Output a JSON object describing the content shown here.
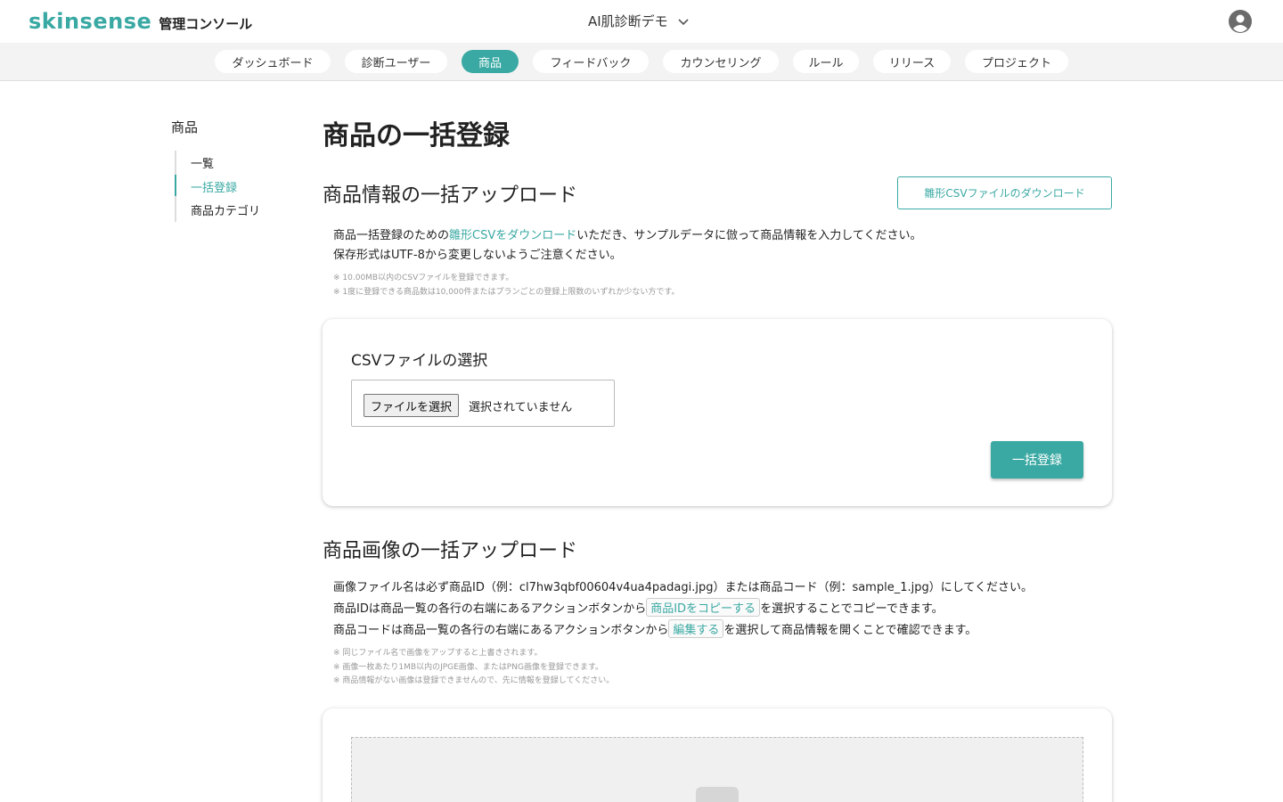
{
  "header": {
    "logo_text": "skinsense",
    "logo_subtitle": "管理コンソール",
    "project_name": "AI肌診断デモ"
  },
  "nav": {
    "tabs": [
      {
        "label": "ダッシュボード"
      },
      {
        "label": "診断ユーザー"
      },
      {
        "label": "商品"
      },
      {
        "label": "フィードバック"
      },
      {
        "label": "カウンセリング"
      },
      {
        "label": "ルール"
      },
      {
        "label": "リリース"
      },
      {
        "label": "プロジェクト"
      }
    ],
    "active": "商品"
  },
  "sidebar": {
    "title": "商品",
    "items": [
      {
        "label": "一覧"
      },
      {
        "label": "一括登録"
      },
      {
        "label": "商品カテゴリ"
      }
    ],
    "active": "一括登録"
  },
  "page": {
    "title": "商品の一括登録"
  },
  "csv_section": {
    "heading": "商品情報の一括アップロード",
    "download_button": "雛形CSVファイルのダウンロード",
    "desc1_pre": "商品一括登録のための",
    "desc1_link": "雛形CSVをダウンロード",
    "desc1_post": "いただき、サンプルデータに倣って商品情報を入力してください。",
    "desc2": "保存形式はUTF-8から変更しないようご注意ください。",
    "note1": "※ 10.00MB以内のCSVファイルを登録できます。",
    "note2": "※ 1度に登録できる商品数は10,000件またはプランごとの登録上限数のいずれか少ない方です。",
    "card_label": "CSVファイルの選択",
    "file_button": "ファイルを選択",
    "file_status": "選択されていません",
    "submit_button": "一括登録"
  },
  "image_section": {
    "heading": "商品画像の一括アップロード",
    "desc1": "画像ファイル名は必ず商品ID（例：cl7hw3qbf00604v4ua4padagi.jpg）または商品コード（例：sample_1.jpg）にしてください。",
    "desc2_pre": "商品IDは商品一覧の各行の右端にあるアクションボタンから",
    "desc2_chip": "商品IDをコピーする",
    "desc2_post": "を選択することでコピーできます。",
    "desc3_pre": "商品コードは商品一覧の各行の右端にあるアクションボタンから",
    "desc3_chip": "編集する",
    "desc3_post": "を選択して商品情報を開くことで確認できます。",
    "note1": "※ 同じファイル名で画像をアップすると上書きされます。",
    "note2": "※ 画像一枚あたり1MB以内のJPGE画像、またはPNG画像を登録できます。",
    "note3": "※ 商品情報がない画像は登録できませんので、先に情報を登録してください。"
  },
  "colors": {
    "accent": "#3aa9a3",
    "nav_bg": "#f3f3f3"
  },
  "icons": {
    "project_dropdown": "chevron-down-icon",
    "account": "account-circle-icon",
    "upload": "image-upload-icon"
  }
}
